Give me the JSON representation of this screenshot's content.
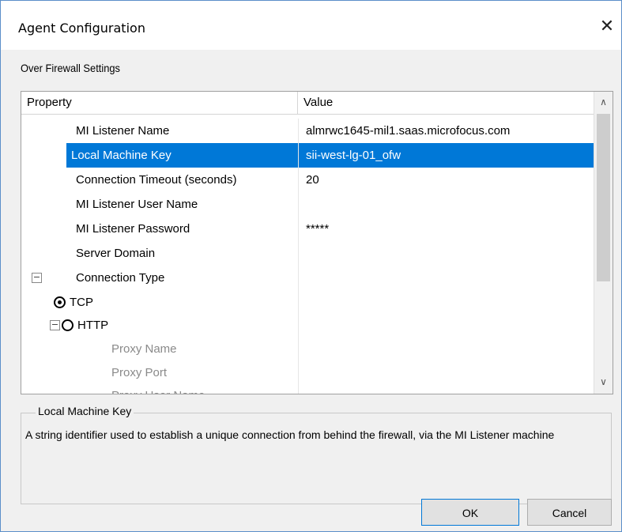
{
  "window": {
    "title": "Agent Configuration",
    "close_glyph": "✕"
  },
  "section_label": "Over Firewall Settings",
  "grid": {
    "columns": [
      "Property",
      "Value"
    ],
    "rows": [
      {
        "name": "MI Listener Name",
        "value": "almrwc1645-mil1.saas.microfocus.com"
      },
      {
        "name": "Local Machine Key",
        "value": "sii-west-lg-01_ofw",
        "selected": true
      },
      {
        "name": "Connection Timeout (seconds)",
        "value": "20"
      },
      {
        "name": "MI Listener User Name",
        "value": ""
      },
      {
        "name": "MI Listener Password",
        "value": "*****"
      },
      {
        "name": "Server Domain",
        "value": ""
      },
      {
        "name": "Connection Type",
        "value": "",
        "expander": "−"
      },
      {
        "name": "TCP",
        "value": "",
        "radio": "on"
      },
      {
        "name": "HTTP",
        "value": "",
        "radio": "off",
        "expander": "−"
      },
      {
        "name": "Proxy Name",
        "value": "",
        "dim": true
      },
      {
        "name": "Proxy Port",
        "value": "",
        "dim": true
      },
      {
        "name": "Proxy User Name",
        "value": "",
        "dim": true
      }
    ],
    "scroll_up": "∧",
    "scroll_down": "∨"
  },
  "description": {
    "legend": "Local Machine Key",
    "text": "A string identifier used to establish a unique connection from behind the firewall, via the MI Listener machine"
  },
  "buttons": {
    "ok": "OK",
    "cancel": "Cancel"
  }
}
